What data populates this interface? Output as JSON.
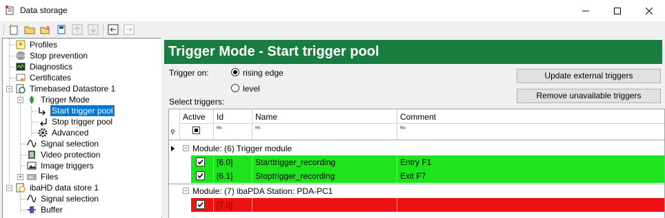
{
  "window": {
    "title": "Data storage"
  },
  "tree": {
    "items": [
      {
        "label": "Profiles",
        "icon": "profiles-icon"
      },
      {
        "label": "Stop prevention",
        "icon": "stop-icon"
      },
      {
        "label": "Diagnostics",
        "icon": "diagnostics-icon"
      },
      {
        "label": "Certificates",
        "icon": "certificate-icon"
      },
      {
        "label": "Timebased Datastore 1",
        "icon": "datastore-icon"
      },
      {
        "label": "Trigger Mode",
        "icon": "trigger-mode-icon"
      },
      {
        "label": "Start trigger pool",
        "icon": "start-trigger-icon"
      },
      {
        "label": "Stop trigger pool",
        "icon": "stop-trigger-icon"
      },
      {
        "label": "Advanced",
        "icon": "gear-icon"
      },
      {
        "label": "Signal selection",
        "icon": "signal-icon"
      },
      {
        "label": "Video protection",
        "icon": "video-icon"
      },
      {
        "label": "Image triggers",
        "icon": "image-icon"
      },
      {
        "label": "Files",
        "icon": "files-icon"
      },
      {
        "label": "ibaHD data store 1",
        "icon": "hd-datastore-icon"
      },
      {
        "label": "Signal selection",
        "icon": "signal-icon"
      },
      {
        "label": "Buffer",
        "icon": "buffer-icon"
      }
    ]
  },
  "panel": {
    "title": "Trigger Mode - Start trigger pool",
    "trigger_on_label": "Trigger on:",
    "radio_rising": "rising edge",
    "radio_level": "level",
    "selected_radio": "rising edge",
    "select_triggers_label": "Select triggers:",
    "btn_update": "Update external triggers",
    "btn_remove": "Remove unavailable triggers"
  },
  "grid": {
    "columns": {
      "active": "Active",
      "id": "Id",
      "name": "Name",
      "comment": "Comment"
    },
    "filter_glyph": "ᴿᴮᶜ",
    "groups": [
      {
        "label": "Module: (6) Trigger module",
        "rows": [
          {
            "active": true,
            "id": "[6.0]",
            "name": "Starttrigger_recording",
            "comment": "Entry F1",
            "color": "#1ee41e"
          },
          {
            "active": true,
            "id": "[6.1]",
            "name": "Stoptrigger_recording",
            "comment": "Exit F7",
            "color": "#1ee41e"
          }
        ]
      },
      {
        "label": "Module: (7) ibaPDA Station: PDA-PC1",
        "rows": [
          {
            "active": true,
            "id": "[7.0]",
            "name": "",
            "comment": "",
            "color": "#ee1111"
          }
        ]
      }
    ]
  },
  "colors": {
    "header_green": "#1a7d40",
    "ok_green": "#1ee41e",
    "error_red": "#ee1111",
    "selection": "#0078d7"
  }
}
